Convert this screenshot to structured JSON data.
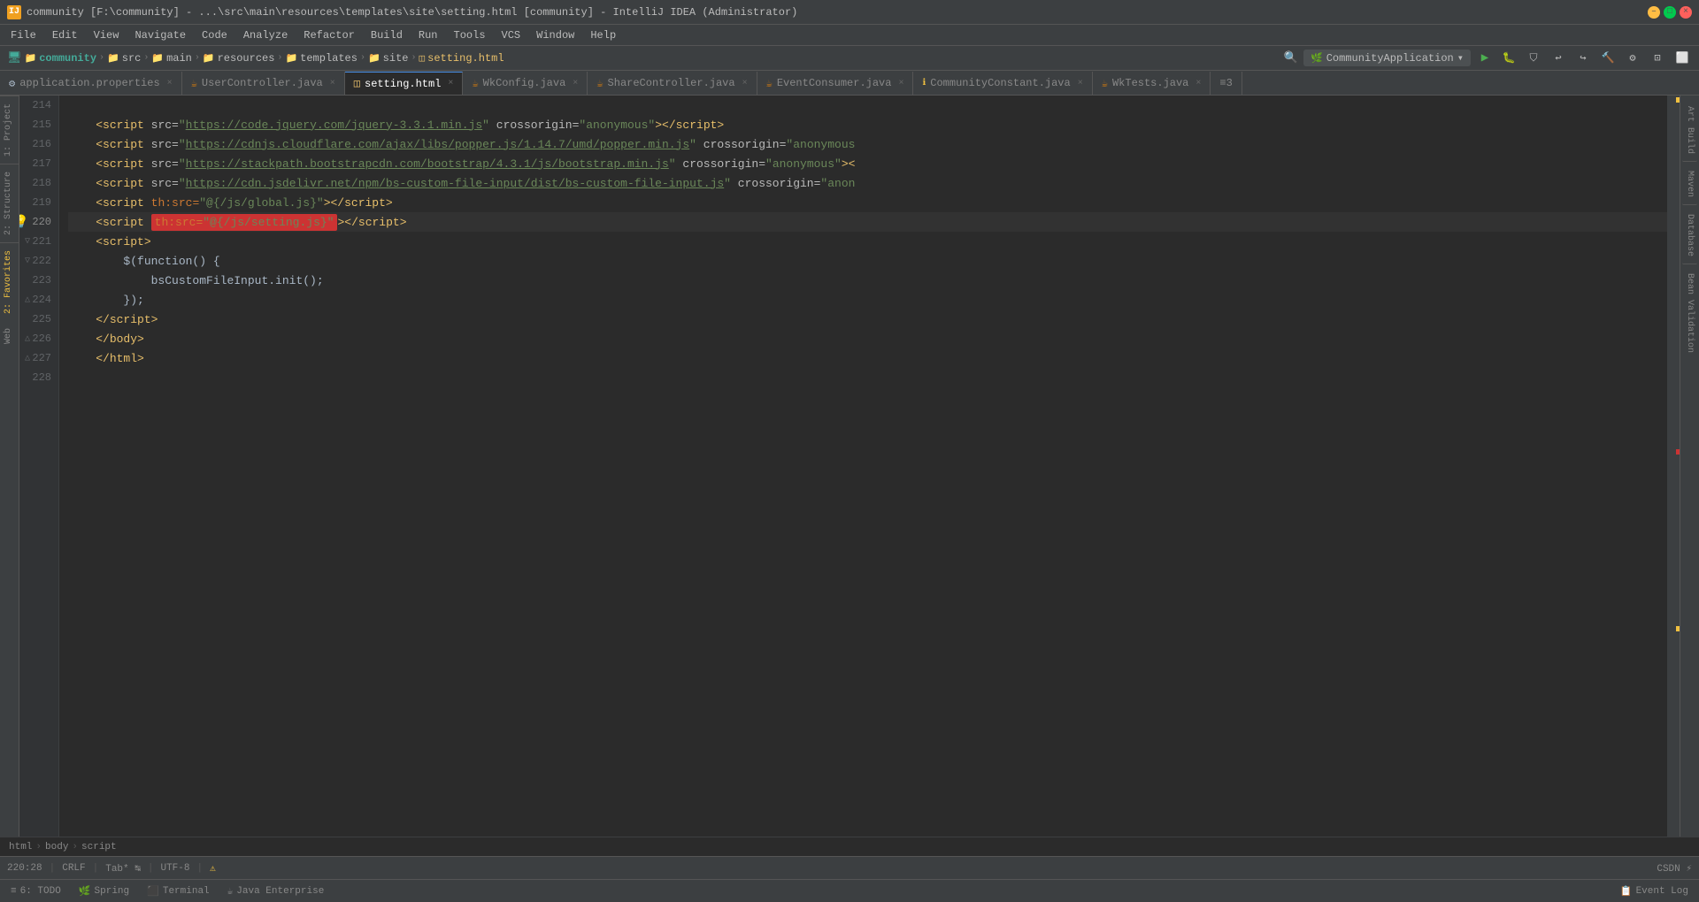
{
  "titleBar": {
    "icon": "IJ",
    "text": "community [F:\\community] - ...\\src\\main\\resources\\templates\\site\\setting.html [community] - IntelliJ IDEA (Administrator)",
    "minimize": "–",
    "maximize": "□",
    "close": "×"
  },
  "menuBar": {
    "items": [
      "File",
      "Edit",
      "View",
      "Navigate",
      "Code",
      "Analyze",
      "Refactor",
      "Build",
      "Run",
      "Tools",
      "VCS",
      "Window",
      "Help"
    ]
  },
  "navBar": {
    "breadcrumb": [
      "community",
      "src",
      "main",
      "resources",
      "templates",
      "site",
      "setting.html"
    ],
    "runConfig": "CommunityApplication",
    "dropdownArrow": "▾"
  },
  "tabs": [
    {
      "name": "application.properties",
      "type": "properties",
      "active": false
    },
    {
      "name": "UserController.java",
      "type": "java",
      "active": false
    },
    {
      "name": "setting.html",
      "type": "html",
      "active": true
    },
    {
      "name": "WkConfig.java",
      "type": "java",
      "active": false
    },
    {
      "name": "ShareController.java",
      "type": "java",
      "active": false
    },
    {
      "name": "EventConsumer.java",
      "type": "java",
      "active": false
    },
    {
      "name": "CommunityConstant.java",
      "type": "java",
      "active": false
    },
    {
      "name": "WkTests.java",
      "type": "java",
      "active": false
    },
    {
      "name": "≡3",
      "type": "more",
      "active": false
    }
  ],
  "codeLines": [
    {
      "num": 214,
      "content": ""
    },
    {
      "num": 215,
      "content": "    <script src=\"https://code.jquery.com/jquery-3.3.1.min.js\" crossorigin=\"anonymous\"><\\/script>"
    },
    {
      "num": 216,
      "content": "    <script src=\"https://cdnjs.cloudflare.com/ajax/libs/popper.js/1.14.7/umd/popper.min.js\" crossorigin=\"anonymous"
    },
    {
      "num": 217,
      "content": "    <script src=\"https://stackpath.bootstrapcdn.com/bootstrap/4.3.1/js/bootstrap.min.js\" crossorigin=\"anonymous\"><"
    },
    {
      "num": 218,
      "content": "    <script src=\"https://cdn.jsdelivr.net/npm/bs-custom-file-input/dist/bs-custom-file-input.js\" crossorigin=\"anon"
    },
    {
      "num": 219,
      "content": "    <script th:src=\"@{/js/global.js}\"><\\/script>"
    },
    {
      "num": 220,
      "content": "    <script th:src=\"@{/js/setting.js}\"><\\/script>",
      "isCurrentLine": true
    },
    {
      "num": 221,
      "content": "    <script>"
    },
    {
      "num": 222,
      "content": "        $(function() {"
    },
    {
      "num": 223,
      "content": "            bsCustomFileInput.init();"
    },
    {
      "num": 224,
      "content": "        });"
    },
    {
      "num": 225,
      "content": "    <\\/script>"
    },
    {
      "num": 226,
      "content": "    <\\/body>"
    },
    {
      "num": 227,
      "content": "    <\\/html>"
    },
    {
      "num": 228,
      "content": ""
    }
  ],
  "breadcrumb": {
    "parts": [
      "html",
      "body",
      "script"
    ]
  },
  "statusBar": {
    "position": "220:28",
    "lineEnding": "CRLF",
    "indent": "Tab* ↹",
    "encoding": "UTF-8",
    "warnings": "⚠"
  },
  "bottomBar": {
    "todo": "6: TODO",
    "spring": "Spring",
    "terminal": "Terminal",
    "javaEnt": "Java Enterprise",
    "eventLog": "Event Log"
  },
  "rightSideTabs": [
    "Art Build",
    "Maven",
    "Database",
    "Bean Validation"
  ],
  "leftSideTabs": [
    "1: Project",
    "2: Structure",
    "2: Favorites",
    "Web"
  ]
}
